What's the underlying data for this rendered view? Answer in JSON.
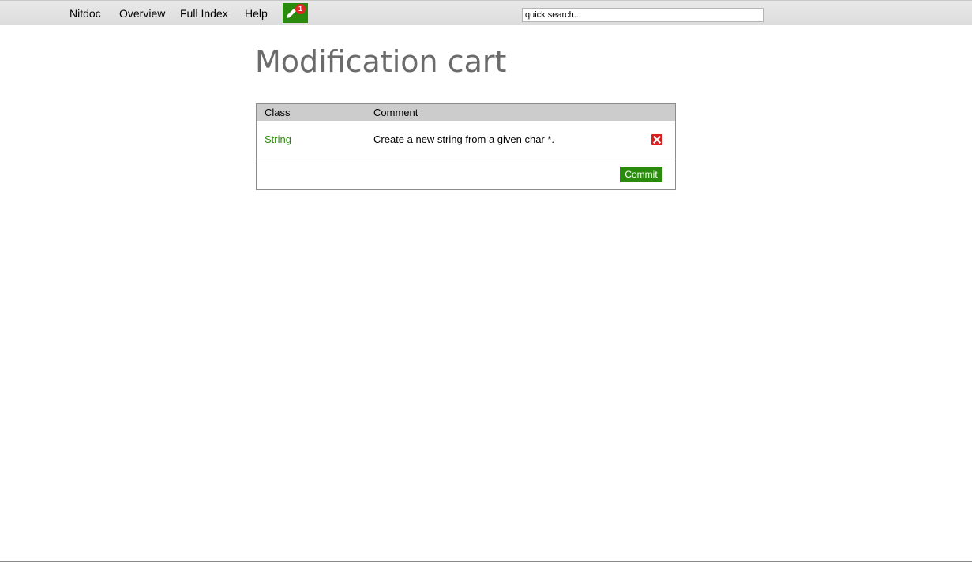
{
  "nav": {
    "links": [
      "Nitdoc",
      "Overview",
      "Full Index",
      "Help"
    ],
    "cart_count": "1",
    "cart_icon": "pencil-icon",
    "search_placeholder": "quick search..."
  },
  "page": {
    "title": "Modification cart"
  },
  "cart": {
    "columns": [
      "Class",
      "Comment"
    ],
    "rows": [
      {
        "class": "String",
        "comment": "Create a new string from a given char *.",
        "delete_icon": "close-icon"
      }
    ],
    "commit_label": "Commit"
  },
  "colors": {
    "accent_green": "#2a8a0c",
    "delete_red": "#d81e1e",
    "badge_red": "#e12626",
    "title_gray": "#6b6b6b",
    "header_gray": "#cccccc"
  }
}
